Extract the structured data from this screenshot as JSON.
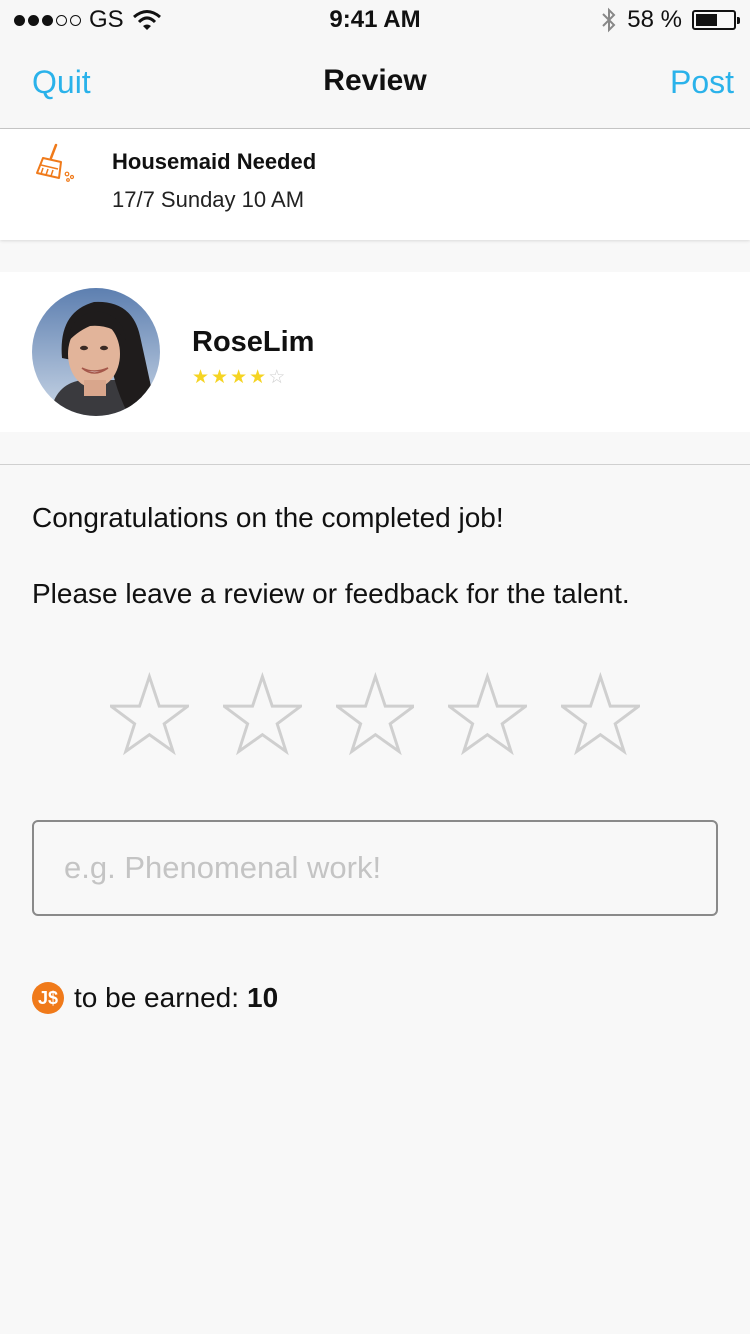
{
  "status_bar": {
    "carrier": "GS",
    "time": "9:41 AM",
    "battery_percent": "58 %",
    "battery_level": 0.58,
    "signal_bars_filled": 3,
    "signal_bars_total": 5
  },
  "nav": {
    "left_label": "Quit",
    "title": "Review",
    "right_label": "Post"
  },
  "job": {
    "icon": "broom-icon",
    "title": "Housemaid Needed",
    "date": "17/7 Sunday 10 AM"
  },
  "talent": {
    "name": "RoseLim",
    "rating": 4,
    "rating_max": 5
  },
  "messages": {
    "congrats": "Congratulations on the completed job!",
    "prompt": "Please leave a review or feedback for the talent."
  },
  "review": {
    "rating_selected": 0,
    "rating_max": 5,
    "placeholder": "e.g. Phenomenal work!",
    "value": ""
  },
  "earnings": {
    "coin_label": "J$",
    "label": "to be earned:",
    "value": "10"
  },
  "colors": {
    "accent": "#2ab2ea",
    "coin": "#f07a1a",
    "star_on": "#f5d423",
    "star_off": "#cfcfcf"
  }
}
